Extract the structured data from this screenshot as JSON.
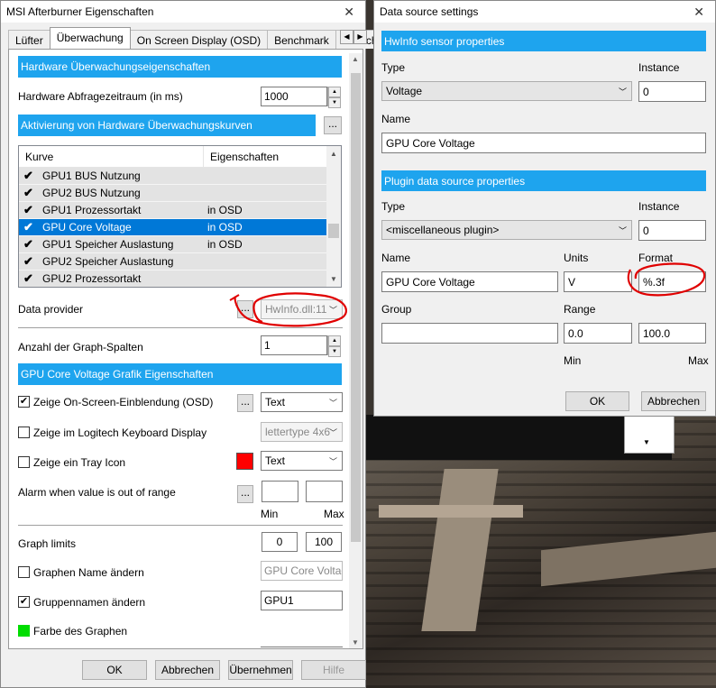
{
  "left_window": {
    "title": "MSI Afterburner Eigenschaften",
    "close": "✕",
    "tabs": [
      "Lüfter",
      "Überwachung",
      "On Screen Display (OSD)",
      "Benchmark",
      "Bildschir"
    ],
    "active_tab": "Überwachung",
    "section1": "Hardware Überwachungseigenschaften",
    "poll_label": "Hardware Abfragezeitraum (in ms)",
    "poll_value": "1000",
    "section2": "Aktivierung von Hardware Überwachungskurven",
    "section2_btn": "...",
    "list": {
      "col_curve": "Kurve",
      "col_props": "Eigenschaften",
      "rows": [
        {
          "name": "GPU1 BUS Nutzung",
          "prop": "",
          "checked": true,
          "selected": false
        },
        {
          "name": "GPU2 BUS Nutzung",
          "prop": "",
          "checked": true,
          "selected": false
        },
        {
          "name": "GPU1 Prozessortakt",
          "prop": "in OSD",
          "checked": true,
          "selected": false
        },
        {
          "name": "GPU Core Voltage",
          "prop": "in OSD",
          "checked": true,
          "selected": true
        },
        {
          "name": "GPU1 Speicher Auslastung",
          "prop": "in OSD",
          "checked": true,
          "selected": false
        },
        {
          "name": "GPU2 Speicher Auslastung",
          "prop": "",
          "checked": true,
          "selected": false
        },
        {
          "name": "GPU2 Prozessortakt",
          "prop": "",
          "checked": true,
          "selected": false
        }
      ]
    },
    "data_provider_label": "Data provider",
    "data_provider_btn": "...",
    "data_provider_value": "HwInfo.dll:11",
    "graph_cols_label": "Anzahl der Graph-Spalten",
    "graph_cols_value": "1",
    "section3": "GPU Core Voltage Grafik Eigenschaften",
    "osd_label": "Zeige On-Screen-Einblendung (OSD)",
    "osd_checked": true,
    "osd_btn": "...",
    "osd_select": "Text",
    "logitech_label": "Zeige im Logitech Keyboard Display",
    "logitech_checked": false,
    "logitech_select": "lettertype 4x6",
    "tray_label": "Zeige ein Tray Icon",
    "tray_checked": false,
    "tray_color": "#ff0000",
    "tray_select": "Text",
    "alarm_label": "Alarm when value is out of range",
    "alarm_btn": "...",
    "alarm_min_label": "Min",
    "alarm_max_label": "Max",
    "alarm_min": "",
    "alarm_max": "",
    "graph_limits_label": "Graph limits",
    "graph_limit_min": "0",
    "graph_limit_max": "100",
    "rename_graph_label": "Graphen Name ändern",
    "rename_graph_checked": false,
    "rename_graph_value": "GPU Core Voltage",
    "group_rename_label": "Gruppennamen ändern",
    "group_rename_checked": true,
    "group_rename_value": "GPU1",
    "graph_color_label": "Farbe des Graphen",
    "graph_color": "#00dd00",
    "buttons": {
      "ok": "OK",
      "cancel": "Abbrechen",
      "apply": "Übernehmen",
      "help": "Hilfe"
    }
  },
  "right_window": {
    "title": "Data source settings",
    "close": "✕",
    "section1": "HwInfo sensor properties",
    "type_label": "Type",
    "instance_label": "Instance",
    "type_value": "Voltage",
    "instance_value": "0",
    "name_label": "Name",
    "name_value": "GPU Core Voltage",
    "section2": "Plugin data source properties",
    "type2_label": "Type",
    "instance2_label": "Instance",
    "type2_value": "<miscellaneous plugin>",
    "instance2_value": "0",
    "name2_label": "Name",
    "units_label": "Units",
    "format_label": "Format",
    "name2_value": "GPU Core Voltage",
    "units_value": "V",
    "format_value": "%.3f",
    "group_label": "Group",
    "range_label": "Range",
    "group_value": "",
    "range_min": "0.0",
    "range_max": "100.0",
    "min_label": "Min",
    "max_label": "Max",
    "ok": "OK",
    "cancel": "Abbrechen"
  },
  "colors": {
    "accent": "#1ea4ee",
    "selection": "#0078d7",
    "annotation": "#e00000"
  }
}
